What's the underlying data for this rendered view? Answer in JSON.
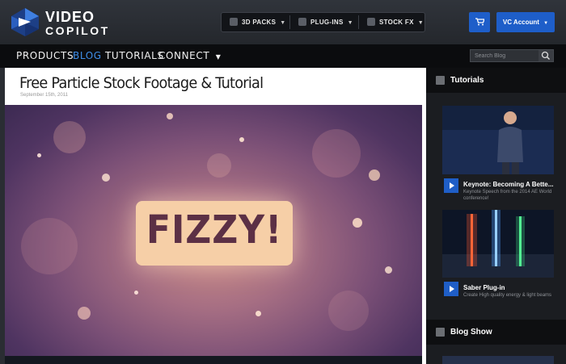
{
  "brand": {
    "line1": "VIDEO",
    "line2": "COPILOT"
  },
  "products": [
    {
      "label": "3D PACKS",
      "icon": "cube-icon"
    },
    {
      "label": "PLUG-INS",
      "icon": "plugin-icon"
    },
    {
      "label": "STOCK FX",
      "icon": "film-icon"
    }
  ],
  "header": {
    "cart_icon": "cart-icon",
    "account_label": "VC Account"
  },
  "nav": {
    "items": [
      "PRODUCTS",
      "BLOG",
      "TUTORIALS",
      "CONNECT"
    ],
    "active": "BLOG",
    "search_placeholder": "Search Blog"
  },
  "article": {
    "title": "Free Particle Stock Footage & Tutorial",
    "date": "September 15th, 2011",
    "hero_text": "FIZZY!"
  },
  "sidebar": {
    "tutorials_heading": "Tutorials",
    "videos": [
      {
        "title": "Keynote: Becoming A Bette...",
        "desc": "Keynote Speech from the 2014 AE World conference!"
      },
      {
        "title": "Saber Plug-in",
        "desc": "Create High quality energy & light beams"
      }
    ],
    "blogshow_heading": "Blog Show"
  },
  "colors": {
    "accent": "#1e5ec9",
    "nav_active": "#3f8ee8",
    "header_bg": "#24272c"
  }
}
